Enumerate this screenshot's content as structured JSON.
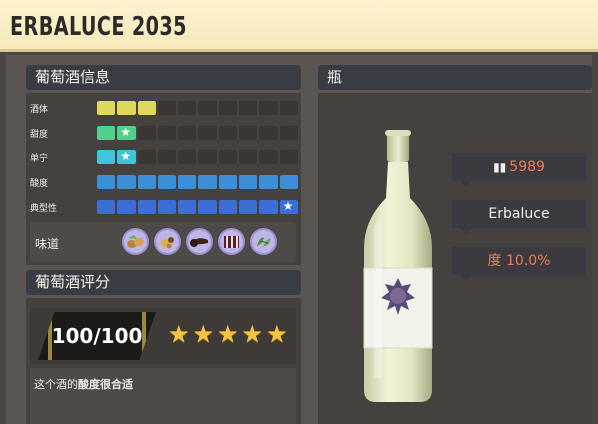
{
  "header": {
    "title": "ERBALUCE 2035"
  },
  "wine_info": {
    "heading": "葡萄酒信息",
    "stats": [
      {
        "label": "酒体",
        "filled": 3,
        "color": "#dcd95c",
        "star_at": null
      },
      {
        "label": "甜度",
        "filled": 2,
        "color": "#4fd08b",
        "star_at": 2
      },
      {
        "label": "单宁",
        "filled": 2,
        "color": "#3ec6d8",
        "star_at": 2
      },
      {
        "label": "酸度",
        "filled": 10,
        "color": "#3c8fd6",
        "star_at": null
      },
      {
        "label": "典型性",
        "filled": 10,
        "color": "#3c6fd6",
        "star_at": 10
      }
    ],
    "segments_total": 10,
    "taste_label": "味道",
    "taste_icons": [
      "nuts-icon",
      "spice-icon",
      "tobacco-icon",
      "dark-fruit-icon",
      "herb-icon"
    ]
  },
  "rating": {
    "heading": "葡萄酒评分",
    "score": "100/100",
    "stars": 5,
    "comment_prefix": "这个酒的",
    "comment_bold": "酸度很合适"
  },
  "bottle": {
    "heading": "瓶",
    "count": "5989",
    "name": "Erbaluce",
    "abv": "度 10.0%"
  },
  "colors": {
    "accent_orange": "#f07b52",
    "star_yellow": "#f4c542"
  }
}
